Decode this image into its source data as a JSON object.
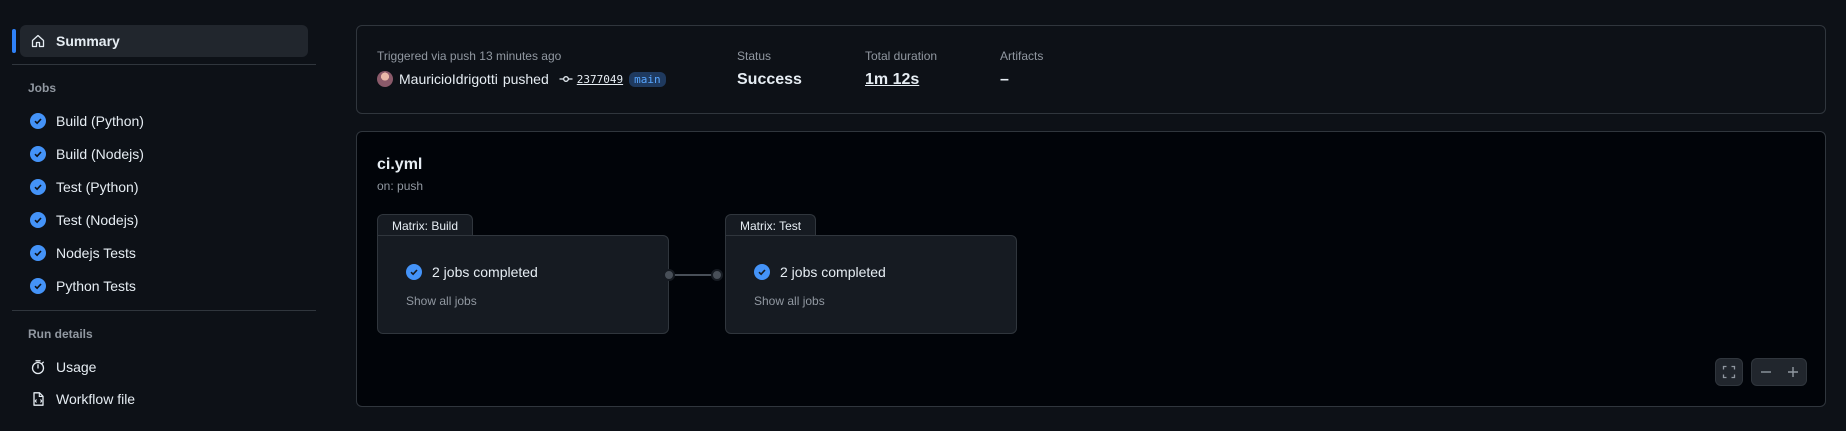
{
  "sidebar": {
    "summary_label": "Summary",
    "jobs_title": "Jobs",
    "jobs": [
      {
        "label": "Build (Python)"
      },
      {
        "label": "Build (Nodejs)"
      },
      {
        "label": "Test (Python)"
      },
      {
        "label": "Test (Nodejs)"
      },
      {
        "label": "Nodejs Tests"
      },
      {
        "label": "Python Tests"
      }
    ],
    "run_details_title": "Run details",
    "usage_label": "Usage",
    "workflow_file_label": "Workflow file"
  },
  "summary": {
    "triggered_text": "Triggered via push 13 minutes ago",
    "actor": "MauricioIdrigotti",
    "action": "pushed",
    "commit": "2377049",
    "branch": "main",
    "status_label": "Status",
    "status_value": "Success",
    "duration_label": "Total duration",
    "duration_value": "1m 12s",
    "artifacts_label": "Artifacts",
    "artifacts_value": "–"
  },
  "workflow": {
    "title": "ci.yml",
    "subtitle": "on: push",
    "matrices": [
      {
        "tab_label": "Matrix: Build",
        "jobs_text": "2 jobs completed",
        "show_all": "Show all jobs"
      },
      {
        "tab_label": "Matrix: Test",
        "jobs_text": "2 jobs completed",
        "show_all": "Show all jobs"
      }
    ]
  },
  "colors": {
    "accent": "#2f81f7",
    "success_check": "#4493f8",
    "background": "#0d1117"
  }
}
